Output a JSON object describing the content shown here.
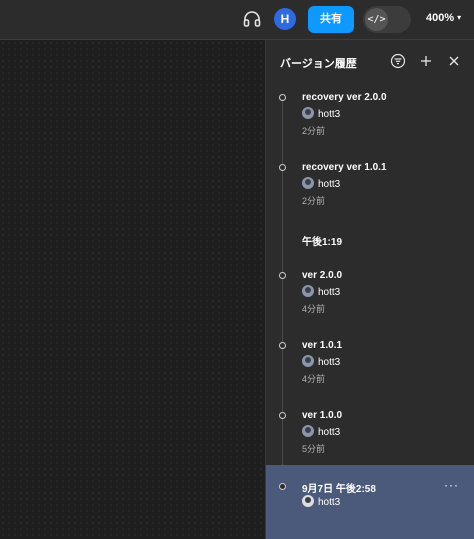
{
  "toolbar": {
    "avatar_initial": "H",
    "share_label": "共有",
    "dev_mode_glyph": "</>",
    "zoom_level": "400%"
  },
  "panel": {
    "title": "バージョン履歴"
  },
  "versions": [
    {
      "title": "recovery ver 2.0.0",
      "user": "hott3",
      "time": "2分前"
    },
    {
      "title": "recovery ver 1.0.1",
      "user": "hott3",
      "time": "2分前"
    },
    {
      "group": "午後1:19"
    },
    {
      "title": "ver 2.0.0",
      "user": "hott3",
      "time": "4分前"
    },
    {
      "title": "ver 1.0.1",
      "user": "hott3",
      "time": "4分前"
    },
    {
      "title": "ver 1.0.0",
      "user": "hott3",
      "time": "5分前"
    }
  ],
  "current": {
    "title": "9月7日 午後2:58",
    "user": "hott3",
    "more_glyph": "···"
  },
  "colors": {
    "accent": "#0d99ff",
    "selected_row": "#4b5a7a",
    "avatar": "#2f6be0"
  }
}
